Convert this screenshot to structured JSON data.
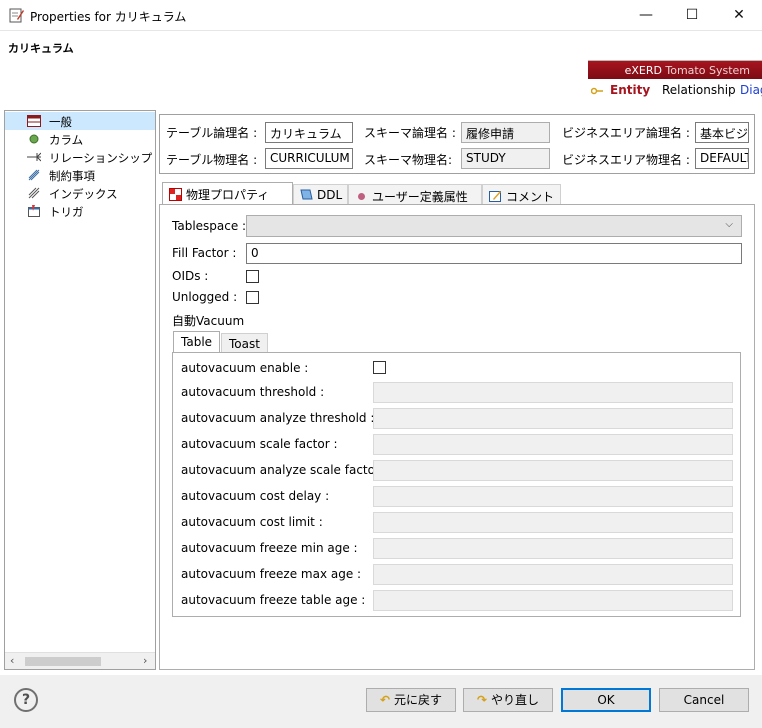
{
  "window": {
    "title": "Properties for カリキュラム",
    "minimize": "—",
    "maximize": "☐",
    "close": "✕"
  },
  "header": {
    "title": "カリキュラム",
    "brand": "eXERD",
    "brand_sub": "Tomato System",
    "tabs": [
      "Entity",
      "Relationship",
      "Diag"
    ]
  },
  "sidebar": {
    "items": [
      {
        "label": "一般",
        "icon": "table-icon",
        "selected": true
      },
      {
        "label": "カラム",
        "icon": "column-dot-icon"
      },
      {
        "label": "リレーションシップ",
        "icon": "relationship-arrow-icon"
      },
      {
        "label": "制約事項",
        "icon": "constraint-icon"
      },
      {
        "label": "インデックス",
        "icon": "index-icon"
      },
      {
        "label": "トリガ",
        "icon": "trigger-icon"
      }
    ]
  },
  "fields": {
    "logical_name_label": "テーブル論理名 :",
    "logical_name": "カリキュラム",
    "physical_name_label": "テーブル物理名 :",
    "physical_name": "CURRICULUM",
    "schema_logical_label": "スキーマ論理名 :",
    "schema_logical": "履修申請",
    "schema_physical_label": "スキーマ物理名:",
    "schema_physical": "STUDY",
    "biz_logical_label": "ビジネスエリア論理名 :",
    "biz_logical": "基本ビジ",
    "biz_physical_label": "ビジネスエリア物理名 :",
    "biz_physical": "DEFAULT"
  },
  "tabs": [
    {
      "label": "物理プロパティ",
      "icon": "properties-icon",
      "active": true
    },
    {
      "label": "DDL",
      "icon": "ddl-icon"
    },
    {
      "label": "ユーザー定義属性",
      "icon": "user-attr-icon"
    },
    {
      "label": "コメント",
      "icon": "comment-icon"
    }
  ],
  "physical": {
    "tablespace_label": "Tablespace :",
    "tablespace_value": "",
    "fill_factor_label": "Fill Factor :",
    "fill_factor_value": "0",
    "oids_label": "OIDs :",
    "unlogged_label": "Unlogged :",
    "autovacuum_label": "自動Vacuum",
    "inner_tabs": [
      "Table",
      "Toast"
    ],
    "enable_label": "autovacuum enable :",
    "rows": [
      "autovacuum threshold :",
      "autovacuum analyze threshold :",
      "autovacuum scale factor :",
      "autovacuum analyze scale factor :",
      "autovacuum cost delay :",
      "autovacuum cost limit :",
      "autovacuum freeze min age :",
      "autovacuum freeze max age :",
      "autovacuum freeze table age :"
    ]
  },
  "buttons": {
    "help": "?",
    "restore": "元に戻す",
    "redo": "やり直し",
    "ok": "OK",
    "cancel": "Cancel"
  }
}
